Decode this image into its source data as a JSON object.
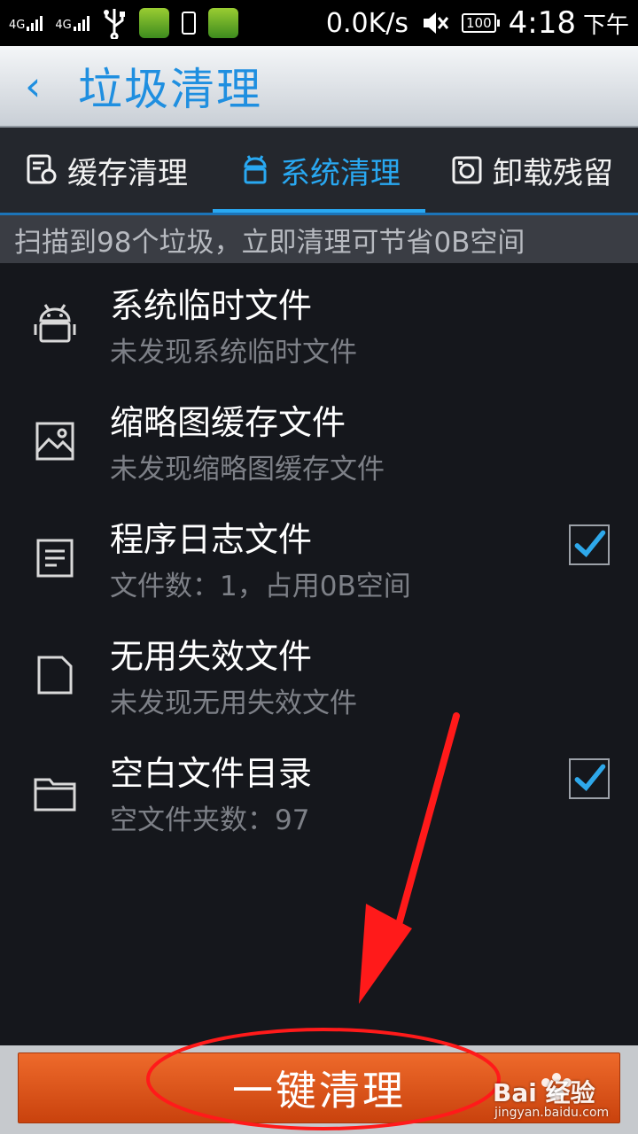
{
  "status_bar": {
    "signal_1": "4G",
    "signal_2": "4G",
    "net_speed": "0.0K/s",
    "battery": "100",
    "time": "4:18",
    "ampm": "下午"
  },
  "header": {
    "back_glyph": "‹",
    "title": "垃圾清理"
  },
  "tabs": [
    {
      "label": "缓存清理",
      "icon": "cache-clean-icon",
      "active": false
    },
    {
      "label": "系统清理",
      "icon": "android-icon",
      "active": true
    },
    {
      "label": "卸载残留",
      "icon": "uninstall-icon",
      "active": false
    }
  ],
  "summary": "扫描到98个垃圾，立即清理可节省0B空间",
  "items": [
    {
      "title": "系统临时文件",
      "subtitle": "未发现系统临时文件",
      "icon": "android-icon",
      "checked": false
    },
    {
      "title": "缩略图缓存文件",
      "subtitle": "未发现缩略图缓存文件",
      "icon": "image-icon",
      "checked": false
    },
    {
      "title": "程序日志文件",
      "subtitle": "文件数：1，占用0B空间",
      "icon": "document-icon",
      "checked": true
    },
    {
      "title": "无用失效文件",
      "subtitle": "未发现无用失效文件",
      "icon": "blank-file-icon",
      "checked": false
    },
    {
      "title": "空白文件目录",
      "subtitle": "空文件夹数：97",
      "icon": "folder-icon",
      "checked": true
    }
  ],
  "bottom": {
    "clean_button": "一键清理"
  },
  "watermark": {
    "brand": "Bai 经验",
    "url": "jingyan.baidu.com"
  },
  "colors": {
    "accent": "#29a8f1",
    "button": "#e3591c",
    "annotation": "#ff1a1a"
  }
}
